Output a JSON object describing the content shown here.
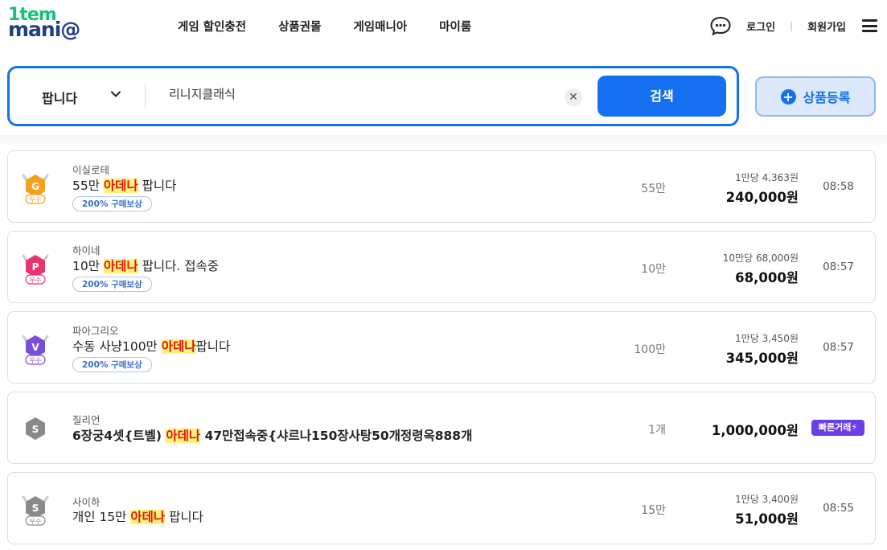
{
  "header": {
    "logo_line1": "1tem",
    "logo_line2_a": "mani",
    "logo_line2_b": "@",
    "nav": [
      "게임 할인충전",
      "상품권몰",
      "게임매니아",
      "마이룸"
    ],
    "login": "로그인",
    "separator": "|",
    "signup": "회원가입"
  },
  "search": {
    "select_value": "팝니다",
    "query": "리니지클래식",
    "clear_glyph": "✕",
    "button": "검색"
  },
  "register_button": {
    "plus": "+",
    "label": "상품등록"
  },
  "listings": [
    {
      "badge": {
        "letter": "G",
        "grade": "우수",
        "color": "#f3a020"
      },
      "server": "이실로테",
      "title_before": "55만 ",
      "keyword": "아데나",
      "title_after": " 팝니다",
      "reward": "200% 구매보상",
      "qty": "55만",
      "unit_price": "1만당 4,363원",
      "price": "240,000원",
      "time": "08:58"
    },
    {
      "badge": {
        "letter": "P",
        "grade": "우수",
        "color": "#e8356b"
      },
      "server": "하이네",
      "title_before": "10만 ",
      "keyword": "아데나",
      "title_after": " 팝니다. 접속중",
      "reward": "200% 구매보상",
      "qty": "10만",
      "unit_price": "10만당 68,000원",
      "price": "68,000원",
      "time": "08:57"
    },
    {
      "badge": {
        "letter": "V",
        "grade": "우수",
        "color": "#7a4fd8"
      },
      "server": "파아그리오",
      "title_before": "수동 사냥100만 ",
      "keyword": "아데나",
      "title_after": "팝니다",
      "reward": "200% 구매보상",
      "qty": "100만",
      "unit_price": "1만당 3,450원",
      "price": "345,000원",
      "time": "08:57"
    },
    {
      "badge": {
        "letter": "S",
        "grade": "",
        "color": "#8a8a8a"
      },
      "server": "질리언",
      "title_before": "6장궁4셋{트벨) ",
      "keyword": "아데나",
      "title_after": " 47만접속중{샤르나150장사탕50개정령옥888개",
      "reward": "",
      "qty": "1개",
      "unit_price": "",
      "price": "1,000,000원",
      "fast": "빠른거래",
      "time": ""
    },
    {
      "badge": {
        "letter": "S",
        "grade": "우수",
        "color": "#8a8a8a"
      },
      "server": "사이하",
      "title_before": "개인 15만 ",
      "keyword": "아데나",
      "title_after": " 팝니다",
      "reward": "",
      "qty": "15만",
      "unit_price": "1만당 3,400원",
      "price": "51,000원",
      "time": "08:55"
    }
  ],
  "icons": {
    "chat": "chat-bubble-icon",
    "menu": "hamburger-menu-icon",
    "chevron": "chevron-down-icon",
    "clear": "close-icon",
    "plus": "plus-circle-icon",
    "fast": "lightning-icon"
  },
  "colors": {
    "accent": "#1570ef",
    "highlight_bg": "#fff27a",
    "highlight_text": "#e0140f",
    "fast_badge": "#6b3fe6"
  }
}
